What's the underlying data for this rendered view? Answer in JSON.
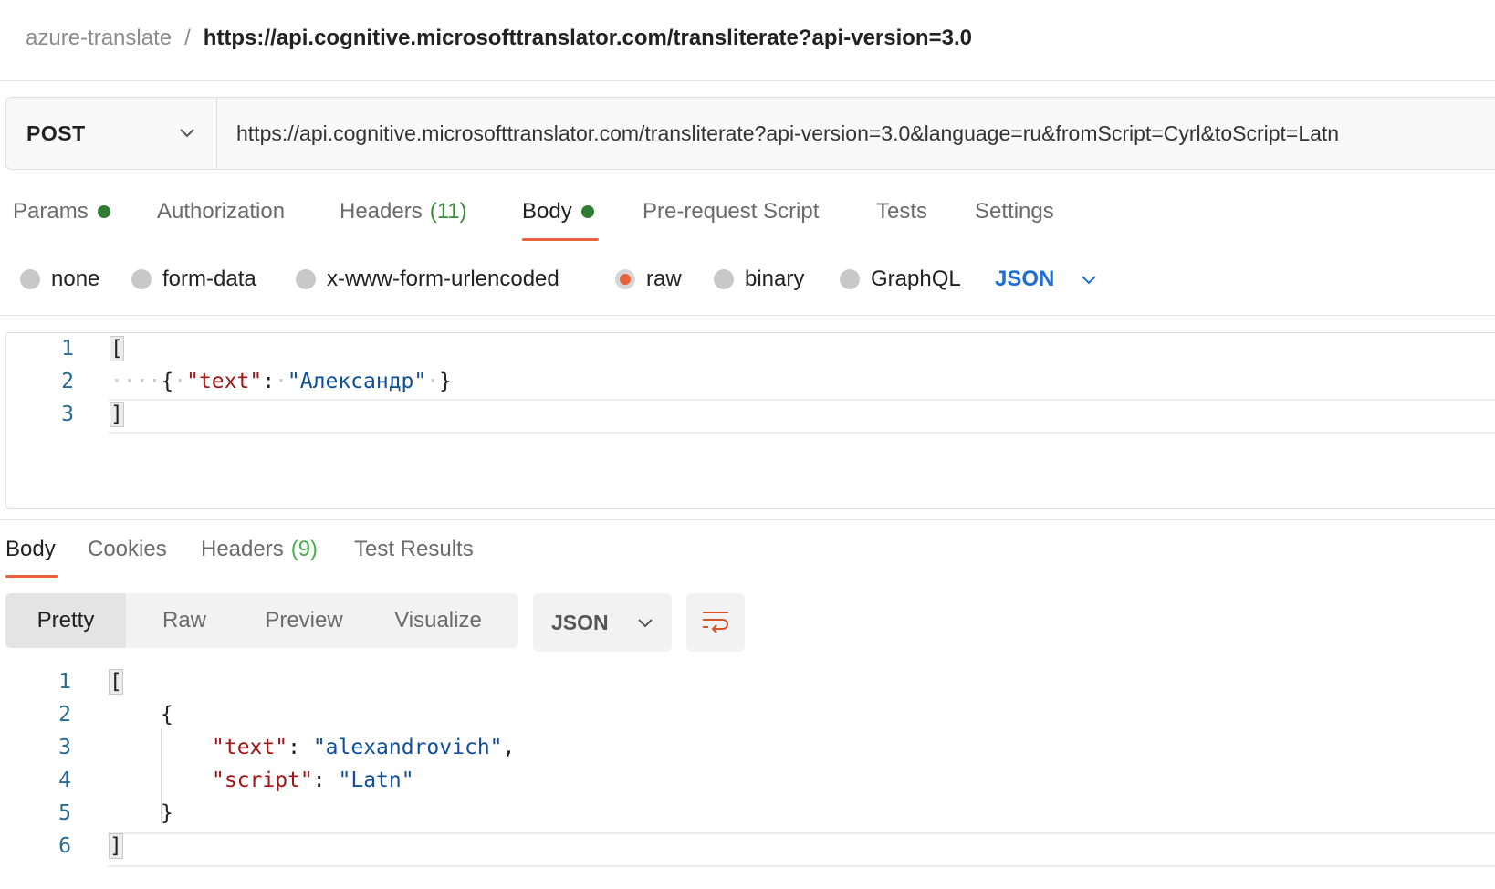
{
  "breadcrumb": {
    "collection": "azure-translate",
    "separator": "/",
    "request": "https://api.cognitive.microsofttranslator.com/transliterate?api-version=3.0"
  },
  "request": {
    "method": "POST",
    "url": "https://api.cognitive.microsofttranslator.com/transliterate?api-version=3.0&language=ru&fromScript=Cyrl&toScript=Latn"
  },
  "request_tabs": {
    "params": "Params",
    "authorization": "Authorization",
    "headers": "Headers",
    "headers_count": "(11)",
    "body": "Body",
    "prerequest": "Pre-request Script",
    "tests": "Tests",
    "settings": "Settings",
    "active": "Body"
  },
  "body_types": {
    "none": "none",
    "form_data": "form-data",
    "urlencoded": "x-www-form-urlencoded",
    "raw": "raw",
    "binary": "binary",
    "graphql": "GraphQL",
    "selected": "raw",
    "language": "JSON"
  },
  "request_body": {
    "line_numbers": [
      "1",
      "2",
      "3"
    ],
    "open_bracket": "[",
    "brace_open": "{",
    "key": "\"text\"",
    "colon": ":",
    "value": "\"Александр\"",
    "brace_close": "}",
    "close_bracket": "]"
  },
  "response_tabs": {
    "body": "Body",
    "cookies": "Cookies",
    "headers": "Headers",
    "headers_count": "(9)",
    "test_results": "Test Results",
    "active": "Body"
  },
  "views": {
    "pretty": "Pretty",
    "raw": "Raw",
    "preview": "Preview",
    "visualize": "Visualize",
    "active": "Pretty",
    "format": "JSON",
    "wrap_icon": "wrap-lines-icon"
  },
  "response_body": {
    "line_numbers": [
      "1",
      "2",
      "3",
      "4",
      "5",
      "6"
    ],
    "open_bracket": "[",
    "brace_open": "{",
    "key1": "\"text\"",
    "value1": "\"alexandrovich\"",
    "comma": ",",
    "key2": "\"script\"",
    "value2": "\"Latn\"",
    "colon": ":",
    "brace_close": "}",
    "close_bracket": "]"
  },
  "colors": {
    "accent": "#e8623c",
    "status_dot": "#2e7d32",
    "link_blue": "#1e6ed6",
    "json_key": "#a31515",
    "json_string": "#0f4e9a"
  }
}
